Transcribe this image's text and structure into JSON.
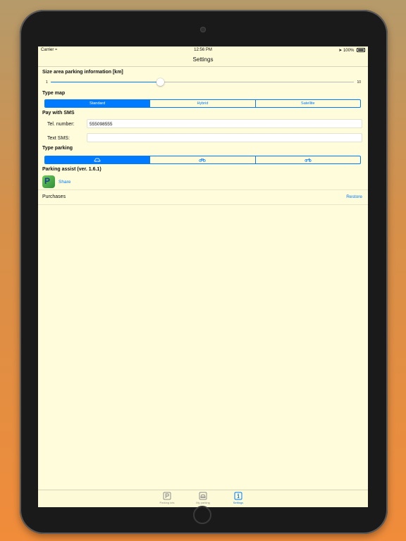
{
  "status_bar": {
    "carrier": "Carrier",
    "time": "12:56 PM",
    "battery": "100%"
  },
  "nav": {
    "title": "Settings"
  },
  "size_area": {
    "header": "Size area parking information [km]",
    "min_label": "1",
    "max_label": "10",
    "value_fraction": 0.36
  },
  "type_map": {
    "header": "Type map",
    "options": [
      "Standard",
      "Hybrid",
      "Satellite"
    ],
    "selected": "Standard"
  },
  "pay_sms": {
    "header": "Pay with SMS",
    "tel_label": "Tel. number:",
    "tel_value": "555098555",
    "text_label": "Text SMS:",
    "text_value": ""
  },
  "type_parking": {
    "header": "Type parking",
    "options": [
      "car-icon",
      "bicycle-icon",
      "motorcycle-icon"
    ],
    "selected": "car-icon"
  },
  "about": {
    "header": "Parking assist (ver. 1.6.1)",
    "share_label": "Share",
    "app_icon_letter": "P"
  },
  "purchases": {
    "label": "Purchases",
    "restore_label": "Restore"
  },
  "tabs": [
    {
      "label": "Parking lots",
      "icon": "parking-icon"
    },
    {
      "label": "My parking",
      "icon": "car-icon"
    },
    {
      "label": "Settings",
      "icon": "info-icon"
    }
  ],
  "colors": {
    "accent": "#007aff",
    "background": "#fffcdc"
  }
}
